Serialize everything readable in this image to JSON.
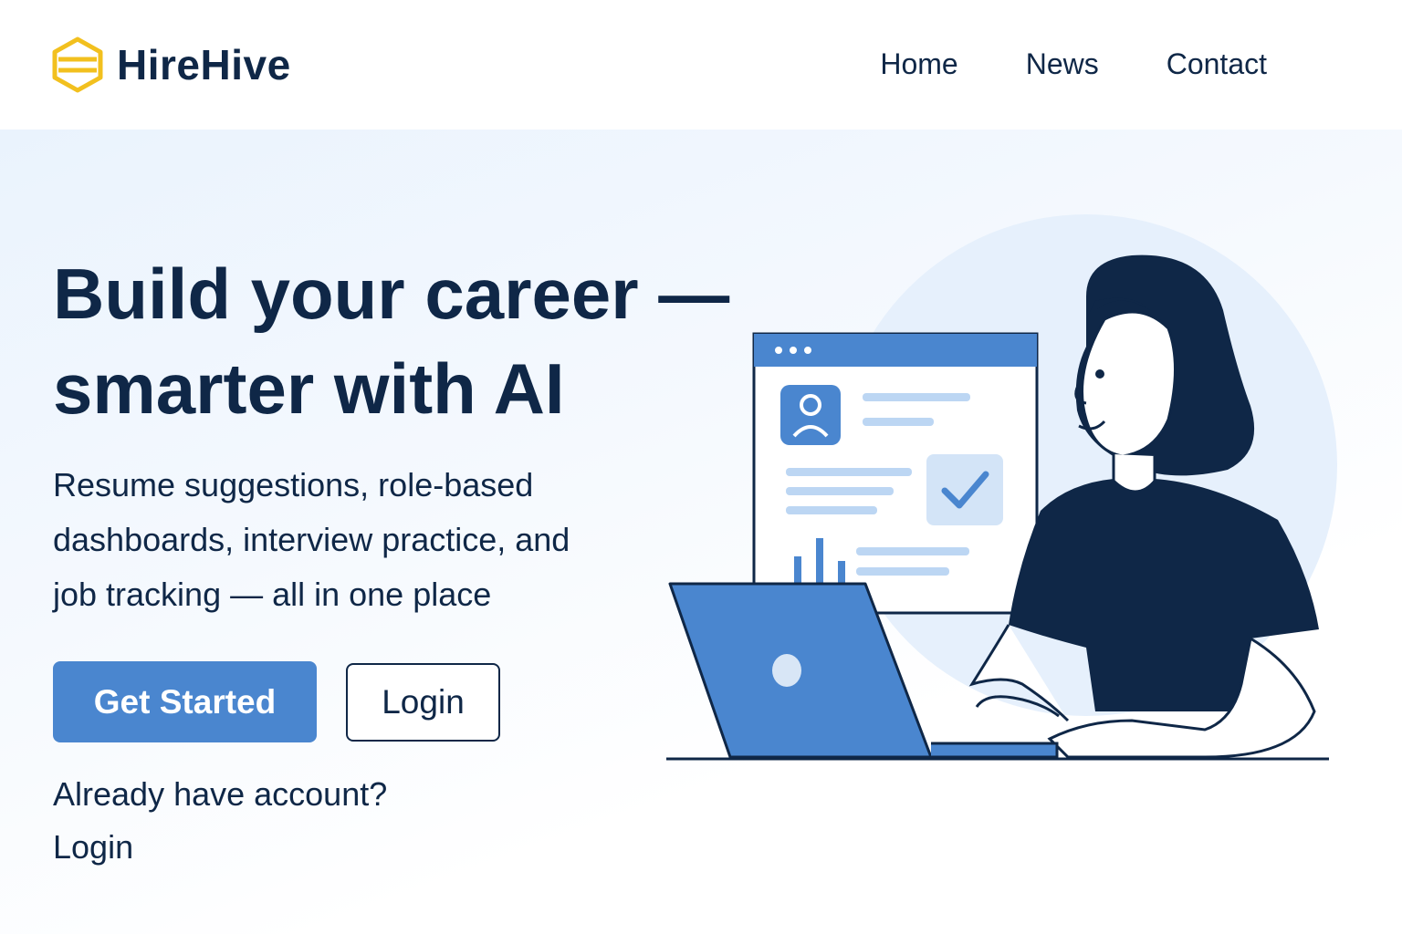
{
  "header": {
    "brand": "HireHive",
    "logo_icon": "hexagon-logo-icon",
    "nav": [
      {
        "label": "Home"
      },
      {
        "label": "News"
      },
      {
        "label": "Contact"
      }
    ]
  },
  "hero": {
    "headline_line1": "Build your career —",
    "headline_line2": "smarter with AI",
    "subtext_line1": "Resume suggestions, role-based",
    "subtext_line2": "dashboards, interview practice, and",
    "subtext_line3": "job tracking — all in one place",
    "primary_button": "Get Started",
    "secondary_button": "Login",
    "account_question": "Already have account?",
    "account_login": "Login"
  },
  "colors": {
    "brand_dark": "#0f2747",
    "accent_blue": "#4a86cf",
    "logo_yellow": "#f2c01e",
    "light_blue": "#e6f0fc"
  },
  "illustration": {
    "subject": "woman-at-laptop-illustration"
  }
}
